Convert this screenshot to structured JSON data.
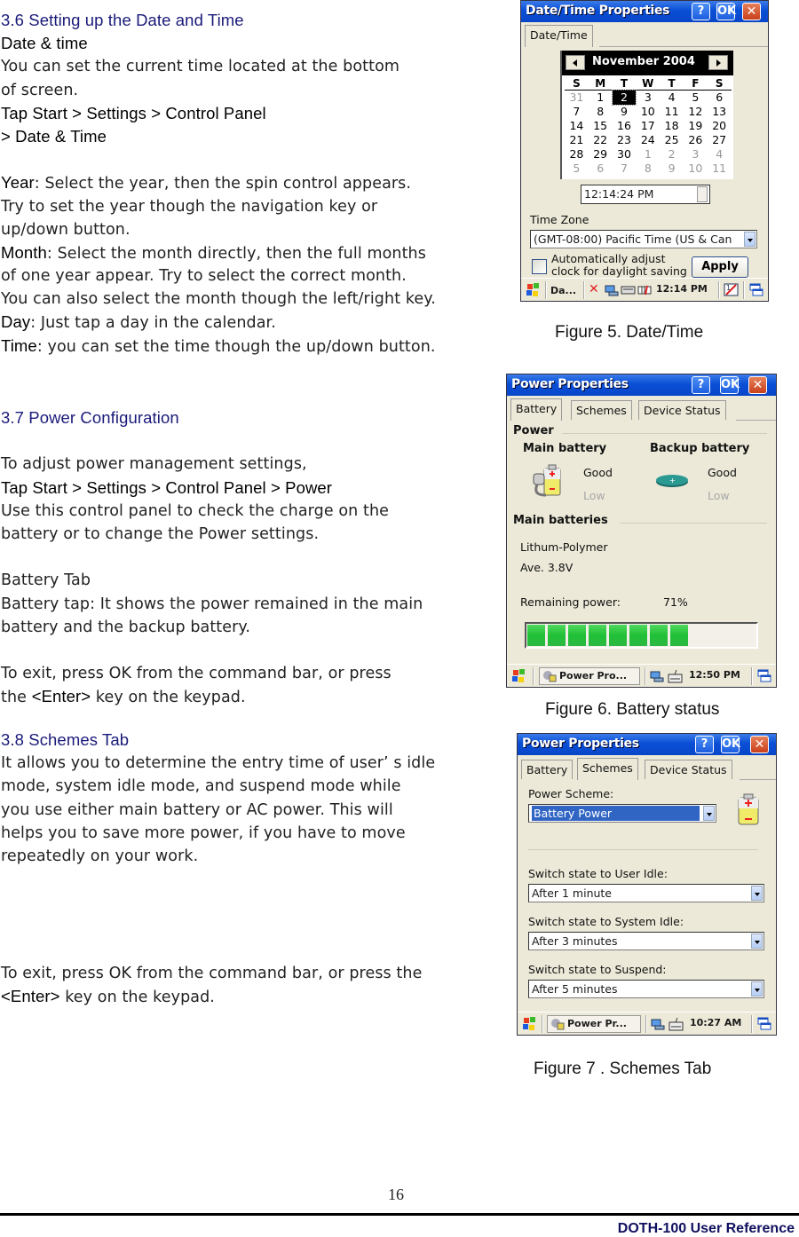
{
  "sections": {
    "s36": {
      "heading": "3.6 Setting up the Date and Time",
      "subheading": "Date & time",
      "intro": [
        "You can set the current time located at the bottom",
        "of screen."
      ],
      "nav": [
        "Tap Start > Settings > Control Panel",
        "> Date & Time"
      ],
      "year": {
        "kw": "Year",
        "lines": [
          ": Select the year, then the spin control appears.",
          "Try to set the year though the navigation key or",
          "up/down button."
        ]
      },
      "month": {
        "kw": "Month",
        "lines": [
          ": Select the month directly, then the full months",
          "of one year appear. Try to select the correct month.",
          "You can also select the month though the left/right key."
        ]
      },
      "day": {
        "kw": "Day",
        "text": ": Just tap a day in the calendar."
      },
      "time": {
        "kw": "Time",
        "text": ": you can set the time though the up/down button."
      }
    },
    "s37": {
      "heading": "3.7 Power Configuration",
      "intro": "To adjust power management settings,",
      "nav": "Tap Start > Settings > Control Panel > Power",
      "desc": [
        "Use this control panel to check the charge on the",
        "battery or to change the Power settings."
      ],
      "battery_tab_title": "Battery Tab",
      "battery_tab_desc": [
        "Battery tap: It shows the power remained in the main",
        "battery and the backup battery."
      ],
      "exit": [
        "To exit, press OK from the command bar, or press",
        "the "
      ],
      "enter_kw": "<Enter>",
      "exit_tail": " key on the keypad."
    },
    "s38": {
      "heading": "3.8 Schemes Tab",
      "desc": [
        "It allows you to determine the entry time of user’ s idle",
        "mode, system idle mode, and suspend mode while",
        "you use either main battery or AC power. This will",
        "helps you to save more power, if you have to move",
        "repeatedly on your work."
      ],
      "exit": "To exit, press OK from the command bar, or press the",
      "enter_kw": "<Enter>",
      "exit_tail": " key on the keypad."
    }
  },
  "figures": {
    "fig5": {
      "caption": "Figure 5. Date/Time",
      "title": "Date/Time Properties",
      "help": "?",
      "ok": "OK",
      "close": "✕",
      "tabs": [
        "Date/Time"
      ],
      "calendar": {
        "month_year": "November 2004",
        "dow": [
          "S",
          "M",
          "T",
          "W",
          "T",
          "F",
          "S"
        ],
        "weeks": [
          [
            {
              "d": "31",
              "o": true
            },
            {
              "d": "1"
            },
            {
              "d": "2",
              "sel": true
            },
            {
              "d": "3"
            },
            {
              "d": "4"
            },
            {
              "d": "5"
            },
            {
              "d": "6"
            }
          ],
          [
            {
              "d": "7"
            },
            {
              "d": "8"
            },
            {
              "d": "9"
            },
            {
              "d": "10"
            },
            {
              "d": "11"
            },
            {
              "d": "12"
            },
            {
              "d": "13"
            }
          ],
          [
            {
              "d": "14"
            },
            {
              "d": "15"
            },
            {
              "d": "16"
            },
            {
              "d": "17"
            },
            {
              "d": "18"
            },
            {
              "d": "19"
            },
            {
              "d": "20"
            }
          ],
          [
            {
              "d": "21"
            },
            {
              "d": "22"
            },
            {
              "d": "23"
            },
            {
              "d": "24"
            },
            {
              "d": "25"
            },
            {
              "d": "26"
            },
            {
              "d": "27"
            }
          ],
          [
            {
              "d": "28"
            },
            {
              "d": "29"
            },
            {
              "d": "30"
            },
            {
              "d": "1",
              "o": true
            },
            {
              "d": "2",
              "o": true
            },
            {
              "d": "3",
              "o": true
            },
            {
              "d": "4",
              "o": true
            }
          ],
          [
            {
              "d": "5",
              "o": true
            },
            {
              "d": "6",
              "o": true
            },
            {
              "d": "7",
              "o": true
            },
            {
              "d": "8",
              "o": true
            },
            {
              "d": "9",
              "o": true
            },
            {
              "d": "10",
              "o": true
            },
            {
              "d": "11",
              "o": true
            }
          ]
        ]
      },
      "time_value": "12:14:24 PM",
      "timezone_label": "Time Zone",
      "timezone_value": "(GMT-08:00) Pacific Time (US & Can",
      "dst_label": [
        "Automatically adjust",
        "clock for daylight saving"
      ],
      "apply": "Apply",
      "taskbar": {
        "task": "Da...",
        "clock": "12:14 PM"
      }
    },
    "fig6": {
      "caption": "Figure 6. Battery status",
      "title": "Power Properties",
      "help": "?",
      "ok": "OK",
      "close": "✕",
      "tabs": [
        "Battery",
        "Schemes",
        "Device Status"
      ],
      "power_group": "Power",
      "main_battery": "Main battery",
      "backup_battery": "Backup battery",
      "good": "Good",
      "low": "Low",
      "main_batteries_group": "Main batteries",
      "chemistry": "Lithum-Polymer",
      "voltage": "Ave. 3.8V",
      "remaining_label": "Remaining power:",
      "remaining_value": "71%",
      "remaining_fraction": 0.71,
      "taskbar": {
        "task": "Power Pro...",
        "clock": "12:50 PM"
      }
    },
    "fig7": {
      "caption": "Figure 7 . Schemes Tab",
      "title": "Power Properties",
      "help": "?",
      "ok": "OK",
      "close": "✕",
      "tabs": [
        "Battery",
        "Schemes",
        "Device Status"
      ],
      "scheme_label": "Power Scheme:",
      "scheme_value": "Battery Power",
      "user_idle_label": "Switch state to User Idle:",
      "user_idle_value": "After 1 minute",
      "system_idle_label": "Switch state to System Idle:",
      "system_idle_value": "After 3 minutes",
      "suspend_label": "Switch state to Suspend:",
      "suspend_value": "After 5 minutes",
      "taskbar": {
        "task": "Power Pr...",
        "clock": "10:27 AM"
      }
    }
  },
  "footer": {
    "page_number": "16",
    "doc_title": "DOTH-100 User Reference"
  },
  "colors": {
    "heading": "#1a1a7a",
    "titlebar": "#0a4fd6",
    "progress": "#20c036",
    "selection": "#3165c4"
  }
}
